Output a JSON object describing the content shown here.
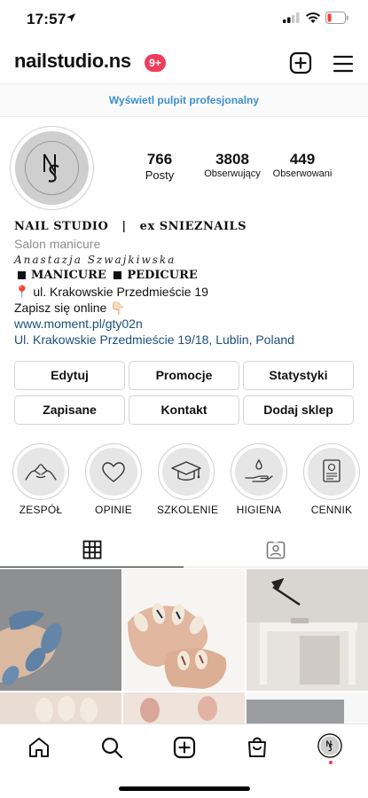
{
  "status_bar": {
    "time": "17:57"
  },
  "header": {
    "username": "nailstudio.ns",
    "notification_badge": "9+"
  },
  "professional_dashboard": {
    "label": "Wyświetl pulpit profesjonalny"
  },
  "profile": {
    "avatar_letters": "NS",
    "stats": [
      {
        "count": "766",
        "label": "Posty"
      },
      {
        "count": "3808",
        "label": "Obserwujący"
      },
      {
        "count": "449",
        "label": "Obserwowani"
      }
    ],
    "bio": {
      "name": "NAIL STUDIO   |   ex SNIEZNAILS",
      "category": "Salon manicure",
      "owner_script": "Anastazja Szwajkiwska",
      "service_1": "MANICURE",
      "service_2": "PEDICURE",
      "address_line": "📍 ul. Krakowskie Przedmieście 19",
      "booking_line": "Zapisz się online 👇🏻",
      "website": "www.moment.pl/gty02n",
      "location": "Ul. Krakowskie Przedmieście 19/18, Lublin, Poland"
    }
  },
  "buttons": {
    "edit": "Edytuj",
    "promotions": "Promocje",
    "insights": "Statystyki",
    "saved": "Zapisane",
    "contact": "Kontakt",
    "add_shop": "Dodaj sklep"
  },
  "highlights": [
    {
      "label": "ZESPÓŁ",
      "icon": "pinky-promise-icon"
    },
    {
      "label": "OPINIE",
      "icon": "heart-icon"
    },
    {
      "label": "SZKOLENIE",
      "icon": "graduation-cap-icon"
    },
    {
      "label": "HIGIENA",
      "icon": "hand-wash-icon"
    },
    {
      "label": "CENNIK",
      "icon": "price-list-icon"
    }
  ],
  "tabs": [
    {
      "name": "posts-grid",
      "icon": "grid-icon",
      "active": true
    },
    {
      "name": "tagged",
      "icon": "tagged-person-icon",
      "active": false
    }
  ],
  "bottom_nav": [
    "home-icon",
    "search-icon",
    "create-icon",
    "shop-icon",
    "profile-avatar"
  ],
  "colors": {
    "badge": "#ef3d5c",
    "link_blue": "#3d8fd0",
    "bio_link": "#1d4f7c"
  }
}
